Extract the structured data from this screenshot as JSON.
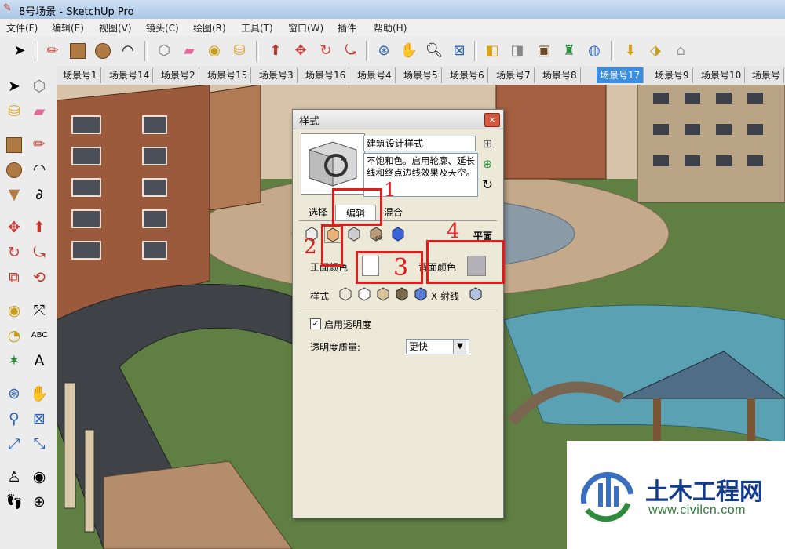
{
  "window": {
    "title": "8号场景 - SketchUp Pro"
  },
  "menu": [
    "文件(F)",
    "编辑(E)",
    "视图(V)",
    "镜头(C)",
    "绘图(R)",
    "工具(T)",
    "窗口(W)",
    "插件",
    "帮助(H)"
  ],
  "scene_tabs": {
    "items": [
      "场景号1",
      "场景号14",
      "场景号2",
      "场景号15",
      "场景号3",
      "场景号16",
      "场景号4",
      "场景号5",
      "场景号6",
      "场景号7",
      "场景号8",
      "场景号17",
      "场景号9",
      "场景号10",
      "场景号"
    ],
    "active": "场景号17"
  },
  "styles_dialog": {
    "title": "样式",
    "close_label": "×",
    "style_name": "建筑设计样式",
    "description": "不饱和色。启用轮廓、延长线和终点边线效果及天空。",
    "tabs": [
      "选择",
      "编辑",
      "混合"
    ],
    "active_tab": "编辑",
    "face_mode_label": "平面",
    "front_color_label": "正面颜色",
    "back_color_label": "背面颜色",
    "front_color": "#ffffff",
    "back_color": "#b4b0b8",
    "style_row_label": "样式",
    "xray_label": "X 射线",
    "transparency_label": "启用透明度",
    "transparency_enabled": true,
    "quality_label": "透明度质量:",
    "quality_value": "更快"
  },
  "annotations": [
    "1",
    "2",
    "3",
    "4"
  ],
  "watermark": {
    "brand": "土木工程网",
    "url": "www.civilcn.com"
  },
  "colors": {
    "accent_red": "#e21b1b",
    "active_tab_blue": "#3a8de0"
  }
}
